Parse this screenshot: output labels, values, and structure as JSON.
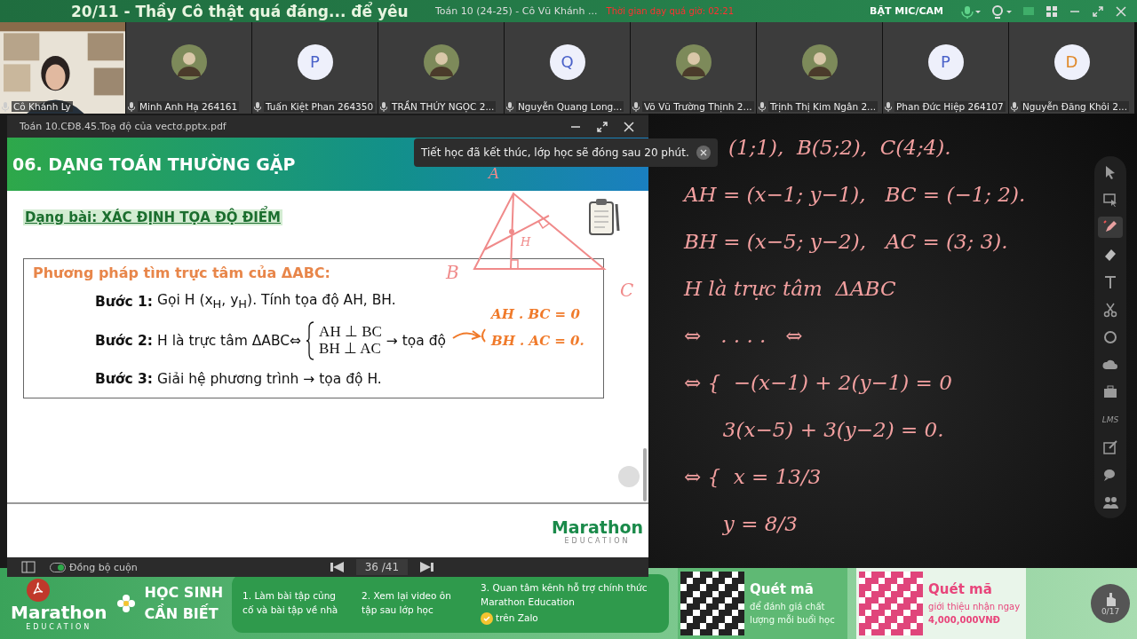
{
  "top_bar": {
    "banner_title": "20/11 - Thầy Cô thật quá đáng... để yêu",
    "class_title": "Toán 10 (24-25) - Cô Vũ Khánh ...",
    "overtime": "Thời gian dạy quá giờ: 02:21",
    "mic_cam": "BẬT MIC/CAM"
  },
  "participants": [
    {
      "kind": "video",
      "name": "Cô Khánh Ly"
    },
    {
      "name": "Minh Anh Hạ 264161"
    },
    {
      "kind": "letter",
      "letter": "P",
      "color": "#4a62c9",
      "name": "Tuấn Kiệt Phan  264350"
    },
    {
      "name": "TRẦN THÚY NGỌC 2..."
    },
    {
      "kind": "letter",
      "letter": "Q",
      "color": "#4a62c9",
      "name": "Nguyễn Quang Long..."
    },
    {
      "name": "Võ Vũ Trường Thịnh 2..."
    },
    {
      "name": "Trịnh Thị Kim Ngân 2..."
    },
    {
      "kind": "letter",
      "letter": "P",
      "color": "#4a62c9",
      "name": "Phan Đức Hiệp 264107"
    },
    {
      "kind": "letter",
      "letter": "D",
      "color": "#e08a2c",
      "name": "Nguyễn Đăng Khôi 2..."
    }
  ],
  "pdf_viewer": {
    "title": "Toán 10.CĐ8.45.Toạ độ của vectơ.pptx.pdf",
    "slide": {
      "heading": "06. DẠNG TOÁN THƯỜNG GẶP",
      "subheading": "Dạng bài: XÁC ĐỊNH TỌA ĐỘ ĐIỂM",
      "box_title": "Phương pháp tìm trực tâm của ΔABC:",
      "steps": [
        {
          "label": "Bước 1:",
          "text": "Gọi H (x$_{H}$, y$_{H}$). Tính tọa độ AH, BH."
        },
        {
          "label": "Bước 2:",
          "text": "H là trực tâm ΔABC⇔",
          "system": [
            "AH ⊥ BC",
            "BH ⊥ AC"
          ],
          "tail": "→ tọa độ"
        },
        {
          "label": "Bước 3:",
          "text": "Giải hệ phương trình → tọa độ H."
        }
      ],
      "annotations": [
        "A",
        "B",
        "C",
        "H",
        "AH . BC = 0",
        "BH . AC = 0."
      ],
      "logo": "Marathon",
      "logo_sub": "EDUCATION"
    },
    "sync_scroll": {
      "label": "Đồng bộ cuộn",
      "on": true
    },
    "page": "36 /41"
  },
  "toast": "Tiết học đã kết thúc, lớp học sẽ đóng sau 20 phút.",
  "board_lines": [
    "(1;1),  B(5;2),  C(4;4).",
    "AH = (x−1; y−1),   BC = (−1; 2).",
    "BH = (x−5; y−2),   AC = (3; 3).",
    "H là trực tâm  ΔABC",
    "⇔   . . . .   ⇔",
    "⇔ {  −(x−1) + 2(y−1) = 0",
    "      3(x−5) + 3(y−2) = 0.",
    "⇔ {  x = 13/3",
    "      y = 8/3"
  ],
  "toolbar": [
    {
      "selected": false
    },
    {
      "selected": false
    },
    {
      "selected": true
    },
    {
      "selected": false
    },
    {
      "selected": false
    },
    {
      "selected": false
    },
    {
      "selected": false
    },
    {
      "selected": false
    },
    {
      "selected": false
    },
    {
      "label": "LMS",
      "selected": false
    },
    {
      "selected": false
    },
    {
      "selected": false
    },
    {
      "selected": false
    }
  ],
  "hand_count": "0/17",
  "banner": {
    "logo": "Marathon",
    "logo_sub": "EDUCATION",
    "heading": [
      "HỌC SINH",
      "CẦN BIẾT"
    ],
    "tips": [
      {
        "text": "1. Làm bài tập củng cố và bài tập về nhà"
      },
      {
        "text": "2. Xem lại video ôn tập sau lớp học"
      },
      {
        "text": "3. Quan tâm kênh hỗ trợ chính thức Marathon Education",
        "after": "trên Zalo"
      }
    ],
    "qr": [
      {
        "title": "Quét mã",
        "text": "để đánh giá chất lượng mỗi buổi học"
      },
      {
        "title": "Quét mã",
        "text": "giới thiệu nhận ngay **4,000,000VNĐ**"
      }
    ]
  }
}
